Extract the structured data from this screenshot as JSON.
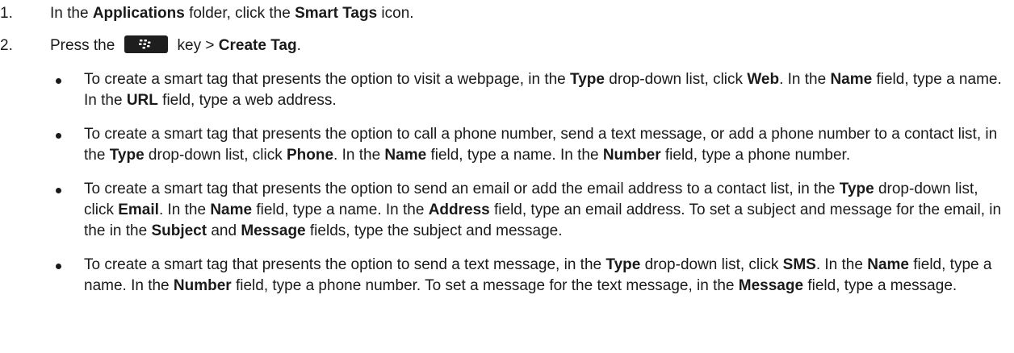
{
  "steps": [
    {
      "number": "1.",
      "parts": [
        "In the ",
        "Applications",
        " folder, click the ",
        "Smart Tags",
        " icon."
      ]
    },
    {
      "number": "2.",
      "before_icon": "Press the",
      "key_icon": "blackberry-menu-key-icon",
      "after_icon": " key > ",
      "bold_end": "Create Tag",
      "end": "."
    }
  ],
  "bullets": [
    {
      "parts": [
        {
          "t": "To create a smart tag that presents the option to visit a webpage, in the ",
          "b": false
        },
        {
          "t": "Type",
          "b": true
        },
        {
          "t": " drop-down list, click ",
          "b": false
        },
        {
          "t": "Web",
          "b": true
        },
        {
          "t": ". In the ",
          "b": false
        },
        {
          "t": "Name",
          "b": true
        },
        {
          "t": " field, type a name. In the ",
          "b": false
        },
        {
          "t": "URL",
          "b": true
        },
        {
          "t": " field, type a web address.",
          "b": false
        }
      ]
    },
    {
      "parts": [
        {
          "t": "To create a smart tag that presents the option to call a phone number, send a text message, or add a phone number to a contact list, in the ",
          "b": false
        },
        {
          "t": "Type",
          "b": true
        },
        {
          "t": " drop-down list, click ",
          "b": false
        },
        {
          "t": "Phone",
          "b": true
        },
        {
          "t": ". In the ",
          "b": false
        },
        {
          "t": "Name",
          "b": true
        },
        {
          "t": " field, type a name. In the ",
          "b": false
        },
        {
          "t": "Number",
          "b": true
        },
        {
          "t": " field, type a phone number.",
          "b": false
        }
      ]
    },
    {
      "parts": [
        {
          "t": "To create a smart tag that presents the option to send an email or add the email address to a contact list, in the ",
          "b": false
        },
        {
          "t": "Type",
          "b": true
        },
        {
          "t": " drop-down list, click ",
          "b": false
        },
        {
          "t": "Email",
          "b": true
        },
        {
          "t": ". In the ",
          "b": false
        },
        {
          "t": "Name",
          "b": true
        },
        {
          "t": " field, type a name. In the ",
          "b": false
        },
        {
          "t": "Address",
          "b": true
        },
        {
          "t": " field, type an email address. To set a subject and message for the email, in the in the ",
          "b": false
        },
        {
          "t": "Subject",
          "b": true
        },
        {
          "t": " and ",
          "b": false
        },
        {
          "t": "Message",
          "b": true
        },
        {
          "t": " fields, type the subject and message.",
          "b": false
        }
      ]
    },
    {
      "parts": [
        {
          "t": "To create a smart tag that presents the option to send a text message, in the ",
          "b": false
        },
        {
          "t": "Type",
          "b": true
        },
        {
          "t": " drop-down list, click ",
          "b": false
        },
        {
          "t": "SMS",
          "b": true
        },
        {
          "t": ". In the ",
          "b": false
        },
        {
          "t": "Name",
          "b": true
        },
        {
          "t": " field, type a name. In the ",
          "b": false
        },
        {
          "t": "Number",
          "b": true
        },
        {
          "t": " field, type a phone number. To set a message for the text message, in the ",
          "b": false
        },
        {
          "t": "Message",
          "b": true
        },
        {
          "t": " field, type a message.",
          "b": false
        }
      ]
    }
  ]
}
